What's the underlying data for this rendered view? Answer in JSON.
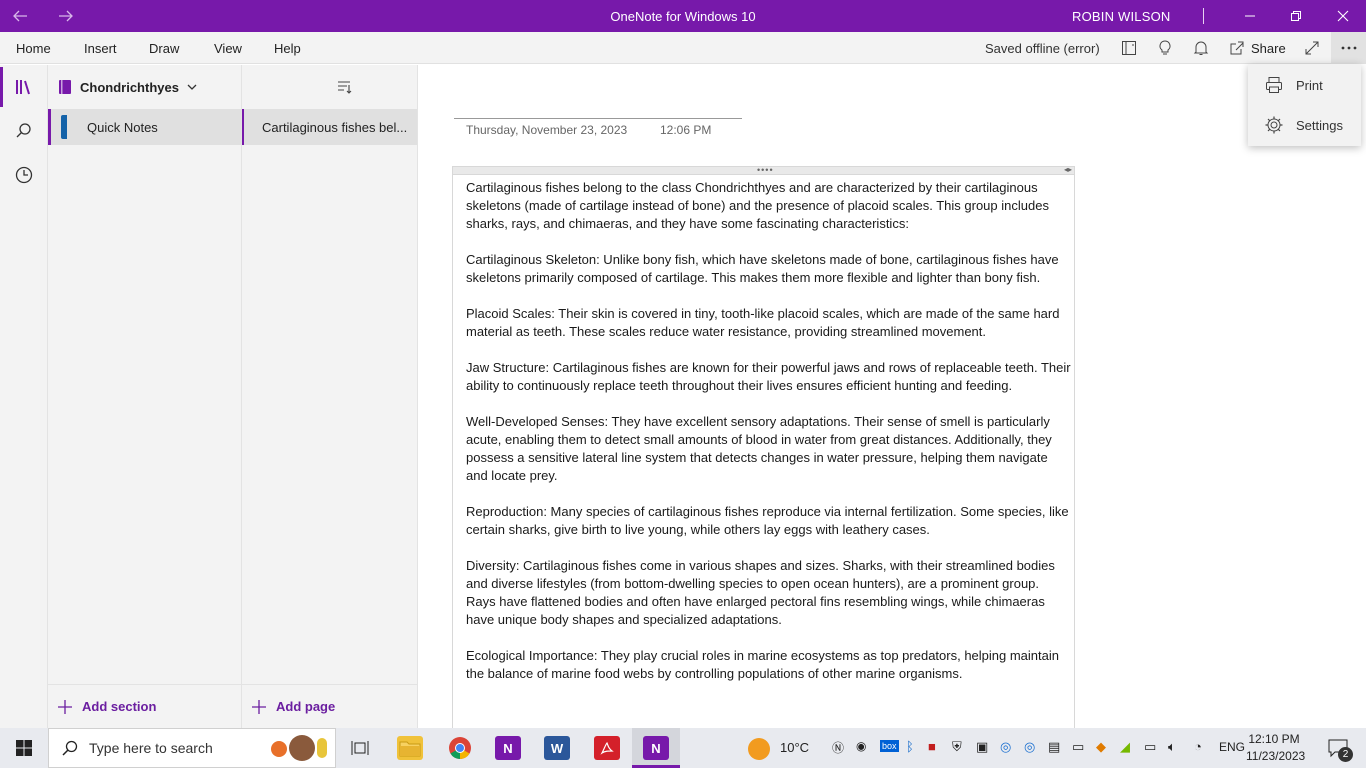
{
  "window": {
    "title": "OneNote for Windows 10",
    "user": "ROBIN WILSON"
  },
  "menu": {
    "items": [
      "Home",
      "Insert",
      "Draw",
      "View",
      "Help"
    ],
    "status": "Saved offline (error)",
    "share_label": "Share"
  },
  "sections_pane": {
    "notebook": "Chondrichthyes",
    "section": "Quick Notes",
    "add_section": "Add section"
  },
  "pages_pane": {
    "page": "Cartilaginous fishes bel...",
    "add_page": "Add page"
  },
  "page": {
    "date": "Thursday, November 23, 2023",
    "time": "12:06 PM",
    "paragraphs": [
      "Cartilaginous fishes belong to the class Chondrichthyes and are characterized by their cartilaginous skeletons (made of cartilage instead of bone) and the presence of placoid scales. This group includes sharks, rays, and chimaeras, and they have some fascinating characteristics:",
      "Cartilaginous Skeleton: Unlike bony fish, which have skeletons made of bone, cartilaginous fishes have skeletons primarily composed of cartilage. This makes them more flexible and lighter than bony fish.",
      "Placoid Scales: Their skin is covered in tiny, tooth-like placoid scales, which are made of the same hard material as teeth. These scales reduce water resistance, providing streamlined movement.",
      "Jaw Structure: Cartilaginous fishes are known for their powerful jaws and rows of replaceable teeth. Their ability to continuously replace teeth throughout their lives ensures efficient hunting and feeding.",
      "Well-Developed Senses: They have excellent sensory adaptations. Their sense of smell is particularly acute, enabling them to detect small amounts of blood in water from great distances. Additionally, they possess a sensitive lateral line system that detects changes in water pressure, helping them navigate and locate prey.",
      "Reproduction: Many species of cartilaginous fishes reproduce via internal fertilization. Some species, like certain sharks, give birth to live young, while others lay eggs with leathery cases.",
      "Diversity: Cartilaginous fishes come in various shapes and sizes. Sharks, with their streamlined bodies and diverse lifestyles (from bottom-dwelling species to open ocean hunters), are a prominent group. Rays have flattened bodies and often have enlarged pectoral fins resembling wings, while chimaeras have unique body shapes and specialized adaptations.",
      "Ecological Importance: They play crucial roles in marine ecosystems as top predators, helping maintain the balance of marine food webs by controlling populations of other marine organisms."
    ]
  },
  "dropdown": {
    "print": "Print",
    "settings": "Settings"
  },
  "taskbar": {
    "search_placeholder": "Type here to search",
    "weather": "10°C",
    "language": "ENG",
    "clock_time": "12:10 PM",
    "clock_date": "11/23/2023",
    "notification_count": "2",
    "icons": [
      "start-icon",
      "task-view-icon",
      "file-explorer-icon",
      "chrome-icon",
      "onenote-2016-icon",
      "word-icon",
      "acrobat-icon",
      "onenote-icon"
    ]
  },
  "colors": {
    "accent": "#7719aa",
    "section_tab": "#1462a8"
  }
}
